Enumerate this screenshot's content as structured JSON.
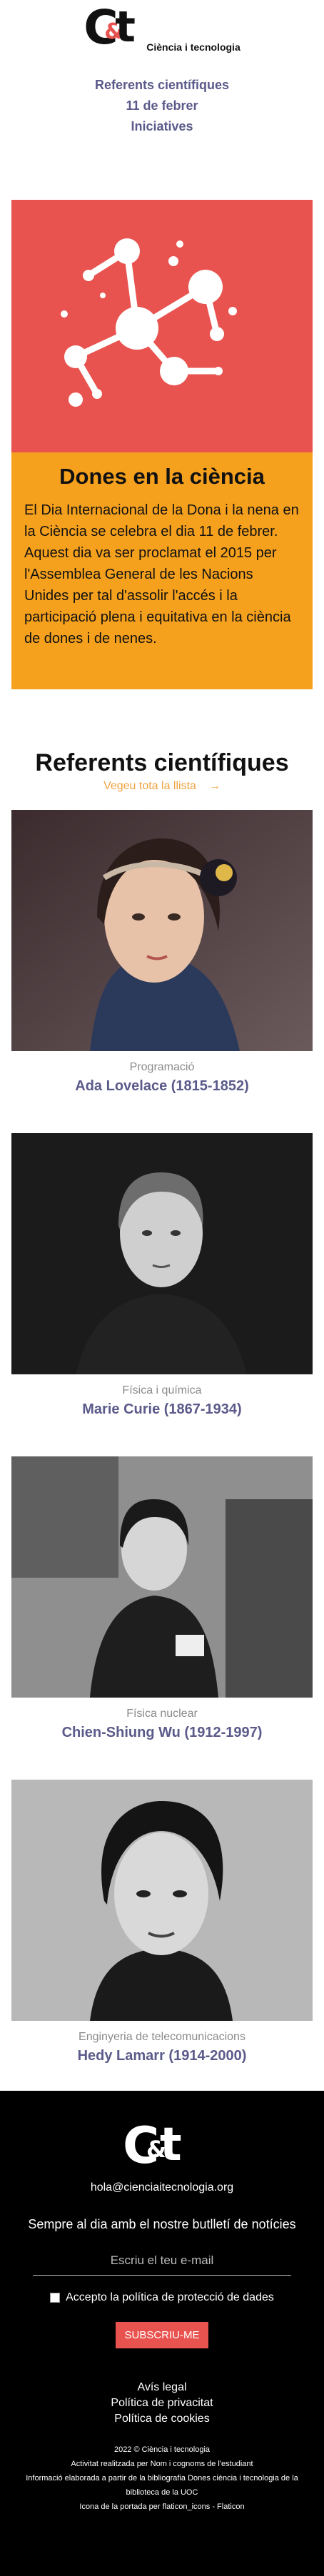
{
  "header": {
    "logo_letters": "C&t",
    "logo_text": "Ciència i tecnologia",
    "nav": [
      "Referents científiques",
      "11 de febrer",
      "Iniciatives"
    ]
  },
  "hero": {
    "title": "Dones en la ciència",
    "text": "El Dia Internacional de la Dona i la nena en la Ciència se celebra el dia 11 de febrer. Aquest dia va ser proclamat el 2015 per l'Assemblea General de les Nacions Unides per tal d'assolir l'accés i la participació plena i equitativa en la ciència de dones i de nenes.",
    "icon": "molecule-icon",
    "colors": {
      "image_bg": "#e9534f",
      "box_bg": "#f6a11e"
    }
  },
  "referents": {
    "title": "Referents científiques",
    "see_all": "Vegeu tota la llista",
    "arrow": "→",
    "cards": [
      {
        "category": "Programació",
        "name": "Ada Lovelace (1815-1852)"
      },
      {
        "category": "Física i química",
        "name": "Marie Curie (1867-1934)"
      },
      {
        "category": "Física nuclear",
        "name": "Chien-Shiung Wu (1912-1997)"
      },
      {
        "category": "Enginyeria de telecomunicacions",
        "name": "Hedy Lamarr (1914-2000)"
      }
    ]
  },
  "footer": {
    "logo_letters": "C&t",
    "email": "hola@cienciaitecnologia.org",
    "newsletter": "Sempre al dia amb el nostre butlletí de notícies",
    "email_placeholder": "Escriu el teu e-mail",
    "privacy_check": "Accepto la política de protecció de dades",
    "subscribe": "SUBSCRIU-ME",
    "links": [
      "Avís legal",
      "Política de privacitat",
      "Política de cookies"
    ],
    "small": [
      "2022 © Ciència i tecnologia",
      "Activitat realitzada per Nom i cognoms de l'estudiant",
      "Informació elaborada a partir de la bibliografia Dones ciència i tecnologia de la biblioteca de la UOC",
      "Icona de la portada per flaticon_icons - Flaticon"
    ]
  }
}
